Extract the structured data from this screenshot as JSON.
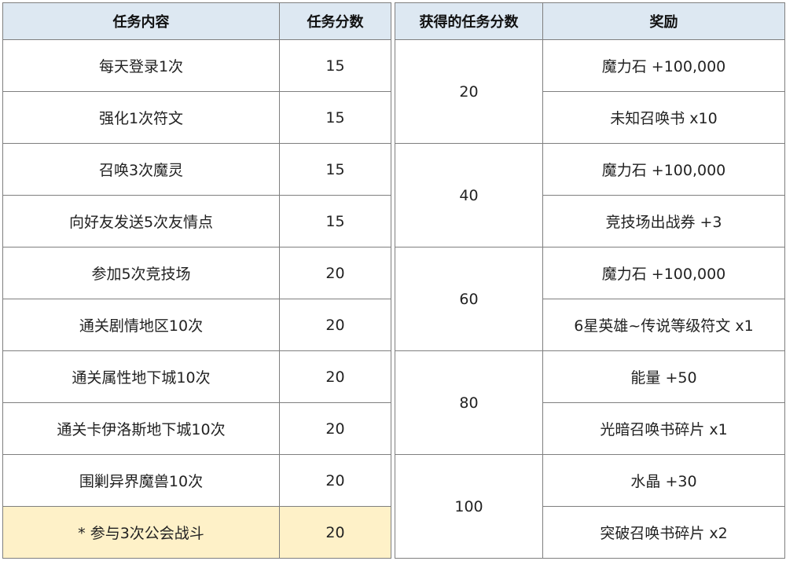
{
  "tasks_table": {
    "headers": {
      "content": "任务内容",
      "points": "任务分数"
    },
    "rows": [
      {
        "content": "每天登录1次",
        "points": "15"
      },
      {
        "content": "强化1次符文",
        "points": "15"
      },
      {
        "content": "召唤3次魔灵",
        "points": "15"
      },
      {
        "content": "向好友发送5次友情点",
        "points": "15"
      },
      {
        "content": "参加5次竞技场",
        "points": "20"
      },
      {
        "content": "通关剧情地区10次",
        "points": "20"
      },
      {
        "content": "通关属性地下城10次",
        "points": "20"
      },
      {
        "content": "通关卡伊洛斯地下城10次",
        "points": "20"
      },
      {
        "content": "围剿异界魔兽10次",
        "points": "20"
      },
      {
        "content": "* 参与3次公会战斗",
        "points": "20",
        "highlight_color": "#fef1c8"
      }
    ]
  },
  "rewards_table": {
    "headers": {
      "points": "获得的任务分数",
      "reward": "奖励"
    },
    "tiers": [
      {
        "points": "20",
        "rewards": [
          "魔力石 +100,000",
          "未知召唤书 x10"
        ]
      },
      {
        "points": "40",
        "rewards": [
          "魔力石 +100,000",
          "竞技场出战券 +3"
        ]
      },
      {
        "points": "60",
        "rewards": [
          "魔力石 +100,000",
          "6星英雄~传说等级符文 x1"
        ]
      },
      {
        "points": "80",
        "rewards": [
          "能量 +50",
          "光暗召唤书碎片 x1"
        ]
      },
      {
        "points": "100",
        "rewards": [
          "水晶 +30",
          "突破召唤书碎片 x2"
        ]
      }
    ]
  },
  "colors": {
    "header_bg": "#dde8f2",
    "border": "#7f7f7f",
    "highlight_bg": "#fef1c8"
  }
}
